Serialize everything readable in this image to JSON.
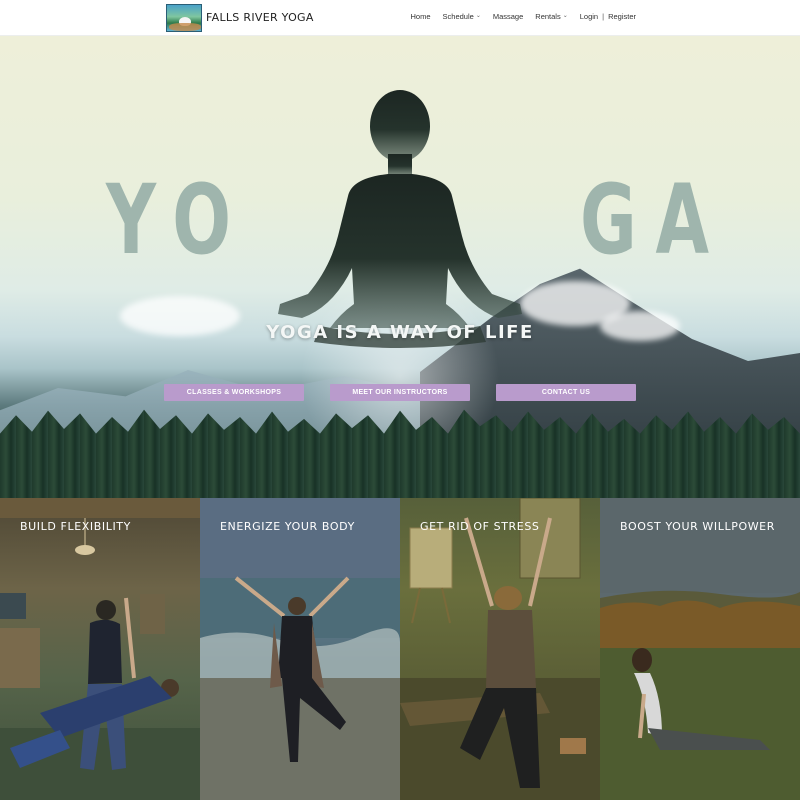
{
  "header": {
    "logo_text": "FALLS RIVER YOGA",
    "nav": [
      {
        "label": "Home",
        "has_dropdown": false
      },
      {
        "label": "Schedule",
        "has_dropdown": true
      },
      {
        "label": "Massage",
        "has_dropdown": false
      },
      {
        "label": "Rentals",
        "has_dropdown": true
      }
    ],
    "login_label": "Login",
    "separator": "|",
    "register_label": "Register"
  },
  "hero": {
    "word_left": "YO",
    "word_right": "GA",
    "tagline": "YOGA IS A WAY OF LIFE",
    "buttons": [
      {
        "label": "CLASSES & WORKSHOPS"
      },
      {
        "label": "MEET OUR INSTRUCTORS"
      },
      {
        "label": "CONTACT US"
      }
    ]
  },
  "panels": [
    {
      "title": "BUILD FLEXIBILITY"
    },
    {
      "title": "ENERGIZE YOUR BODY"
    },
    {
      "title": "GET RID OF STRESS"
    },
    {
      "title": "BOOST YOUR WILLPOWER"
    }
  ],
  "colors": {
    "button_bg": "#b99bcc",
    "yoga_text": "#9fb5ad",
    "silhouette": "#1c2622"
  }
}
